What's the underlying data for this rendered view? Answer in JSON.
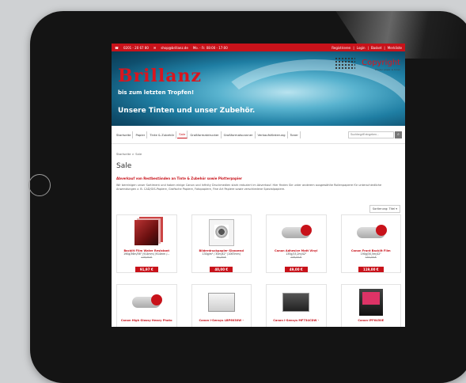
{
  "topbar": {
    "phone": "0201 - 20 67 80",
    "email": "shop@brillanz.de",
    "hours": "Mo. - Fr. 08:00 - 17:00",
    "links": [
      "Registrieren",
      "Login",
      "Basket",
      "Merkliste"
    ]
  },
  "banner": {
    "brand": "Brillanz",
    "tagline1": "bis zum letzten Tropfen!",
    "tagline2": "Unsere Tinten und unser Zubehör.",
    "logo_name": "Copyright",
    "logo_sub": "Printer paper & toner"
  },
  "nav": {
    "items": [
      "Startseite",
      "Papier",
      "Tinte & Zubehör",
      "Sale",
      "Großformatdrucker",
      "Großformatscanner",
      "Verkaufsförderung",
      "Toner"
    ],
    "active_index": 3,
    "search_placeholder": "Suchbegriff eingeben..."
  },
  "breadcrumb": "Startseite > Sale",
  "page_title": "Sale",
  "subhead": "Abverkauf von Restbeständen an Tinte & Zubehör sowie Plotterpapier",
  "description": "Wir bereinigen unser Sortiment und haben einige Canon und Infinity Druckmedien stark reduziert im Abverkauf. Hier finden Sie unter anderem ausgewählte Rollenpapiere für unterschiedliche Anwendungen z. B. CAD/GIS-Papiere, Grafische Papiere, Fotopapiere, Fine Art Papiere sowie verschiedene Spezialpapiere.",
  "sort_label": "Sortierung: Titel",
  "products": [
    {
      "name": "Backlit Film Water Resistant",
      "spec": "190g/36m/36\" (914mm) /914mm /...",
      "old": "118,00 €",
      "price": "91,97 €"
    },
    {
      "name": "Bilderdruckpapier Glanzend",
      "spec": "130g/m² / 30m/42\" (1067mm)",
      "old": "64,00 €",
      "price": "40,00 €"
    },
    {
      "name": "Canon Adhesive Matt Vinyl",
      "spec": "135g/15,2m/42\"",
      "old": "148,00 €",
      "price": "49,00 €"
    },
    {
      "name": "Canon Front Backlit Film",
      "spec": "190g/30,5m/42\"",
      "old": "192,00 €",
      "price": "119,00 €"
    },
    {
      "name": "Canon High Glossy Heavy Photo",
      "spec": "",
      "old": "",
      "price": ""
    },
    {
      "name": "Canon i-Sensys LBP6030W -",
      "spec": "",
      "old": "",
      "price": ""
    },
    {
      "name": "Canon i-Sensys MF734CDW -",
      "spec": "",
      "old": "",
      "price": ""
    },
    {
      "name": "Canon iPF6450E",
      "spec": "",
      "old": "",
      "price": ""
    }
  ]
}
